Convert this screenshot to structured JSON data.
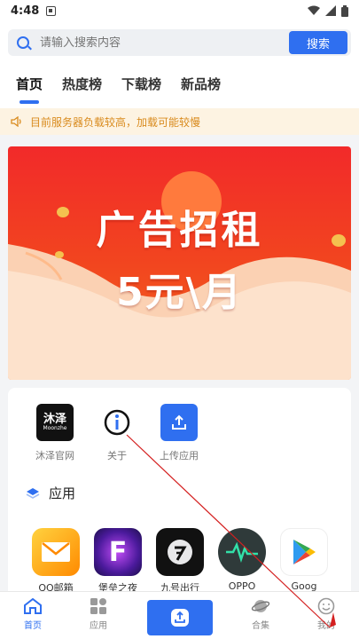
{
  "status": {
    "time": "4:48"
  },
  "search": {
    "placeholder": "请输入搜索内容",
    "button": "搜索"
  },
  "tabs": [
    {
      "label": "首页",
      "active": true
    },
    {
      "label": "热度榜"
    },
    {
      "label": "下载榜"
    },
    {
      "label": "新品榜"
    }
  ],
  "notice": {
    "text": "目前服务器负载较高，加载可能较慢"
  },
  "banner": {
    "line1": "广告招租",
    "line2": "5元\\月"
  },
  "quick": [
    {
      "label": "沐泽官网",
      "icon_text": "沐泽",
      "icon_sub": "Moonzhe"
    },
    {
      "label": "关于"
    },
    {
      "label": "上传应用"
    }
  ],
  "section": {
    "title": "应用"
  },
  "apps": [
    {
      "label": "QQ邮箱"
    },
    {
      "label": "堡垒之夜"
    },
    {
      "label": "九号出行"
    },
    {
      "label": "OPPO"
    },
    {
      "label": "Goog"
    }
  ],
  "nav": {
    "home": "首页",
    "apps": "应用",
    "collection": "合集",
    "mine": "我的"
  },
  "colors": {
    "accent": "#2f6ff0",
    "notice_text": "#d98b1e",
    "banner_red": "#f22a2a"
  }
}
